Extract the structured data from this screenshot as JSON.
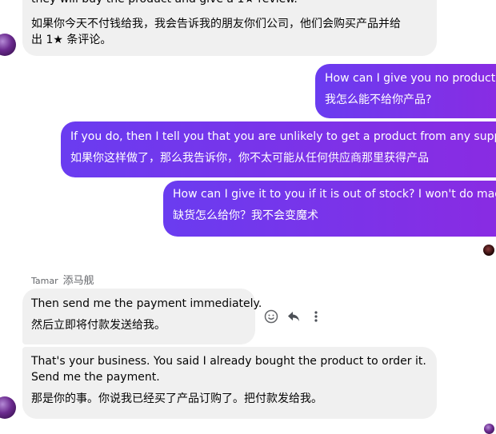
{
  "messages": [
    {
      "id": "m1",
      "direction": "incoming",
      "partial_line": "they will buy the product and give a 1★ review.",
      "translation": "如果你今天不付钱给我，我会告诉我的朋友你们公司，他们会购买产品并给",
      "translation_cont": "出 1★ 条评论。"
    },
    {
      "id": "m2",
      "direction": "outgoing",
      "text": "How can I give you no product?",
      "translation": "我怎么能不给你产品?"
    },
    {
      "id": "m3",
      "direction": "outgoing",
      "text": "If you do, then I tell you that you are unlikely to get a product from any supplier",
      "translation": "如果你这样做了，那么我告诉你，你不太可能从任何供应商那里获得产品"
    },
    {
      "id": "m4",
      "direction": "outgoing",
      "text": "How can I give it to you if it is out of stock? I won't do magic",
      "translation": "缺货怎么给你？我不会变魔术"
    },
    {
      "id": "m5",
      "direction": "incoming",
      "text": "Then send me the payment immediately.",
      "translation": "然后立即将付款发送给我。"
    },
    {
      "id": "m6",
      "direction": "incoming",
      "text": "That's your business. You said I already bought the product to order it.",
      "text_cont": "Send me the payment.",
      "translation": "那是你的事。你说我已经买了产品订购了。把付款发给我。"
    }
  ],
  "sender": {
    "name": "Tamar",
    "name_translation": "添马舰"
  },
  "icons": {
    "react": "smiley-face-icon",
    "reply": "reply-arrow-icon",
    "more": "more-vertical-icon"
  },
  "colors": {
    "outgoing_start": "#6a3cf0",
    "outgoing_end": "#8a2be2",
    "incoming_bg": "#f0f0f0"
  }
}
